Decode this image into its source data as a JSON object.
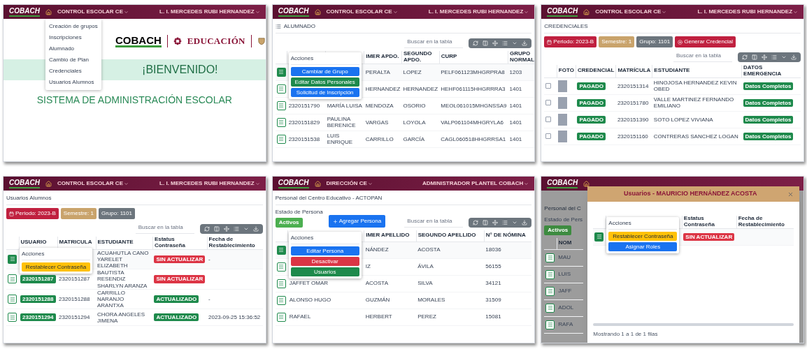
{
  "panels": [
    {
      "kind": "welcome",
      "header": {
        "logo": "COBACH",
        "menu": "CONTROL ESCOLAR CE",
        "user": "L. I. MERCEDES RUBI HERNANDEZ"
      },
      "dropdown": [
        "Creación de grupos",
        "Inscripciones",
        "Alumnado",
        "Cambio de Plan",
        "Credenciales",
        "Usuarios Alumnos"
      ],
      "brand": {
        "logo": "COBACH",
        "education": "EDUCACIÓN"
      },
      "banner": "¡BIENVENIDO!",
      "subtitle": "SISTEMA DE ADMINISTRACIÓN ESCOLAR"
    },
    {
      "kind": "table",
      "header": {
        "logo": "COBACH",
        "menu": "CONTROL ESCOLAR CE",
        "user": "L. I. MERCEDES RUBI HERNANDEZ"
      },
      "title": "ALUMNADO",
      "title_icon": true,
      "search": {
        "placeholder": "Buscar en la tabla"
      },
      "columns": [
        null,
        null,
        "IMER APDO.",
        "SEGUNDO APDO.",
        "CURP",
        "GRUPO NORMAL"
      ],
      "rows": [
        {
          "selected": true,
          "cells": [
            null,
            null,
            {
              "kind": "text",
              "text": "PERALTA"
            },
            {
              "kind": "text",
              "text": "LOPEZ"
            },
            {
              "kind": "text",
              "text": "PELF061123MHGRPRA8"
            },
            {
              "kind": "text",
              "text": "1203"
            }
          ]
        },
        {
          "selected": false,
          "cells": [
            null,
            null,
            {
              "kind": "text",
              "text": "HERNANDEZ"
            },
            {
              "kind": "text",
              "text": "HERNANDEZ"
            },
            {
              "kind": "text",
              "text": "HEHF061115HHGRRRA3"
            },
            {
              "kind": "text",
              "text": "1401"
            }
          ]
        },
        {
          "selected": false,
          "cells": [
            {
              "kind": "text",
              "text": "2320151790"
            },
            {
              "kind": "text",
              "text": "MARÍA LUISA"
            },
            {
              "kind": "text",
              "text": "MENDOZA"
            },
            {
              "kind": "text",
              "text": "OSORIO"
            },
            {
              "kind": "text",
              "text": "MEOL061015MHGNSSA9"
            },
            {
              "kind": "text",
              "text": "1401"
            }
          ]
        },
        {
          "selected": false,
          "cells": [
            {
              "kind": "text",
              "text": "2320151829"
            },
            {
              "kind": "text",
              "text": "PAULINA BERENICE"
            },
            {
              "kind": "text",
              "text": "VARGAS"
            },
            {
              "kind": "text",
              "text": "LOYOLA"
            },
            {
              "kind": "text",
              "text": "VALP061104MHGRYLA6"
            },
            {
              "kind": "text",
              "text": "1401"
            }
          ]
        },
        {
          "selected": false,
          "cells": [
            {
              "kind": "text",
              "text": "2320151538"
            },
            {
              "kind": "text",
              "text": "LUIS ENRIQUE"
            },
            {
              "kind": "text",
              "text": "CARRILLO"
            },
            {
              "kind": "text",
              "text": "GARCÍA"
            },
            {
              "kind": "text",
              "text": "CAGL060518HHGRRSA1"
            },
            {
              "kind": "text",
              "text": "1401"
            }
          ]
        }
      ],
      "actions_menu": {
        "title": "Acciones",
        "buttons": [
          {
            "label": "Cambiar de Grupo",
            "color": "#1a73f0"
          },
          {
            "label": "Editar Datos Personales",
            "color": "#1e8a4c"
          },
          {
            "label": "Solicitud de Inscripción",
            "color": "#1a73f0"
          }
        ]
      }
    },
    {
      "kind": "table",
      "header": {
        "logo": "COBACH",
        "menu": "CONTROL ESCOLAR CE",
        "user": "L. I. MERCEDES RUBI HERNANDEZ"
      },
      "title": "CREDENCIALES",
      "search": {
        "placeholder": "Buscar en la tabla"
      },
      "chips": [
        {
          "kind": "period",
          "label": "Periodo: 2023-B",
          "color": "#c0203f"
        },
        {
          "kind": "semester",
          "label": "Semestre: 1",
          "color": "#c9a36b"
        },
        {
          "kind": "group",
          "label": "Grupo: 1101",
          "color": "#6c757d"
        },
        {
          "kind": "action",
          "label": "Generar Credencial",
          "color": "#c0203f"
        }
      ],
      "columns": [
        "FOTO",
        "CREDENCIAL",
        "MATRÍCULA",
        "ESTUDIANTE",
        "DATOS EMERGENCIA"
      ],
      "rows": [
        {
          "checked": false,
          "cells": [
            {
              "kind": "photo"
            },
            {
              "kind": "badge",
              "text": "PAGADO",
              "color": "#1e8a4c"
            },
            {
              "kind": "text",
              "text": "2320151314"
            },
            {
              "kind": "text",
              "text": "HINOJOSA HERNANDEZ KEVIN OBED"
            },
            {
              "kind": "badge",
              "text": "Datos Completos",
              "color": "#1e8a4c"
            }
          ]
        },
        {
          "checked": false,
          "cells": [
            {
              "kind": "photo"
            },
            {
              "kind": "badge",
              "text": "PAGADO",
              "color": "#1e8a4c"
            },
            {
              "kind": "text",
              "text": "2320151780"
            },
            {
              "kind": "text",
              "text": "VALLE MARTINEZ FERNANDO EMILIANO"
            },
            {
              "kind": "badge",
              "text": "Datos Completos",
              "color": "#1e8a4c"
            }
          ]
        },
        {
          "checked": false,
          "cells": [
            {
              "kind": "photo"
            },
            {
              "kind": "badge",
              "text": "PAGADO",
              "color": "#1e8a4c"
            },
            {
              "kind": "text",
              "text": "2320151390"
            },
            {
              "kind": "text",
              "text": "SOTO LOPEZ VIVIANA"
            },
            {
              "kind": "badge",
              "text": "Datos Completos",
              "color": "#1e8a4c"
            }
          ]
        },
        {
          "checked": false,
          "cells": [
            {
              "kind": "photo"
            },
            {
              "kind": "badge",
              "text": "PAGADO",
              "color": "#1e8a4c"
            },
            {
              "kind": "text",
              "text": "2320151160"
            },
            {
              "kind": "text",
              "text": "CONTRERAS SANCHEZ LOGAN"
            },
            {
              "kind": "badge",
              "text": "Datos Completos",
              "color": "#1e8a4c"
            }
          ]
        }
      ]
    },
    {
      "kind": "table",
      "header": {
        "logo": "COBACH",
        "menu": "CONTROL ESCOLAR CE",
        "user": "L. I. MERCEDES RUBI HERNANDEZ"
      },
      "title": "Usuarios Alumnos",
      "search": {
        "placeholder": "Buscar en la tabla"
      },
      "chips": [
        {
          "kind": "period",
          "label": "Periodo: 2023-B",
          "color": "#c0203f"
        },
        {
          "kind": "semester",
          "label": "Semestre: 1",
          "color": "#c9a36b"
        },
        {
          "kind": "group",
          "label": "Grupo: 1101",
          "color": "#6c757d"
        }
      ],
      "columns": [
        "USUARIO",
        "MATRICULA",
        "ESTUDIANTE",
        "Estatus Contraseña",
        "Fecha de Restablecimiento"
      ],
      "rows": [
        {
          "selected": true,
          "cells": [
            null,
            null,
            {
              "kind": "text",
              "text": "ACUAHUTLA CANO YARELET ELIZABETH"
            },
            {
              "kind": "badge",
              "text": "SIN ACTUALIZAR",
              "color": "#dc3545"
            },
            {
              "kind": "text",
              "text": "-"
            }
          ]
        },
        {
          "selected": false,
          "cells": [
            {
              "kind": "badge",
              "text": "2320151287",
              "color": "#1e8a4c"
            },
            {
              "kind": "text",
              "text": "2320151287"
            },
            {
              "kind": "text",
              "text": "BAUTISTA RESENDIZ SHARLYN ARANZA"
            },
            {
              "kind": "badge",
              "text": "SIN ACTUALIZAR",
              "color": "#dc3545"
            },
            null
          ]
        },
        {
          "selected": false,
          "cells": [
            {
              "kind": "badge",
              "text": "2320151288",
              "color": "#1e8a4c"
            },
            {
              "kind": "text",
              "text": "2320151288"
            },
            {
              "kind": "text",
              "text": "CARRILLO NARANJO ARANTXA"
            },
            {
              "kind": "badge",
              "text": "ACTUALIZADO",
              "color": "#1e8a4c"
            },
            {
              "kind": "text",
              "text": "-"
            }
          ]
        },
        {
          "selected": false,
          "cells": [
            {
              "kind": "badge",
              "text": "2320151294",
              "color": "#1e8a4c"
            },
            {
              "kind": "text",
              "text": "2320151294"
            },
            {
              "kind": "text",
              "text": "CHORA ANGELES JIMENA"
            },
            {
              "kind": "badge",
              "text": "ACTUALIZADO",
              "color": "#1e8a4c"
            },
            {
              "kind": "text",
              "text": "2023-09-25 15:36:52"
            }
          ]
        }
      ],
      "actions_menu": {
        "title": "Acciones",
        "buttons": [
          {
            "label": "Restablecer Contraseña",
            "color": "#ffc107"
          }
        ]
      }
    },
    {
      "kind": "table",
      "header": {
        "logo": "COBACH",
        "menu": "DIRECCIÓN CE",
        "user": "ADMINISTRADOR PLANTEL COBACH"
      },
      "title": "Personal del Centro Educativo - ACTOPAN",
      "search": {
        "placeholder": "Buscar en la tabla"
      },
      "state_filter": {
        "label": "Estado de Persona",
        "value": "Activos",
        "color": "#4caf50"
      },
      "add_button": {
        "label": "Agregar Persona",
        "color": "#1a73f0"
      },
      "columns": [
        null,
        "IMER APELLIDO",
        "SEGUNDO APELLIDO",
        "N° DE NÓMINA"
      ],
      "rows": [
        {
          "selected": true,
          "cells": [
            null,
            {
              "kind": "text",
              "text": "NÁNDEZ"
            },
            {
              "kind": "text",
              "text": "ACOSTA"
            },
            {
              "kind": "text",
              "text": "18036"
            }
          ]
        },
        {
          "selected": false,
          "cells": [
            null,
            {
              "kind": "text",
              "text": "IZ"
            },
            {
              "kind": "text",
              "text": "ÁVILA"
            },
            {
              "kind": "text",
              "text": "56155"
            }
          ]
        },
        {
          "selected": false,
          "cells": [
            {
              "kind": "text",
              "text": "JAFFET OMAR"
            },
            {
              "kind": "text",
              "text": "ACOSTA"
            },
            {
              "kind": "text",
              "text": "SILVA"
            },
            {
              "kind": "text",
              "text": "34121"
            }
          ]
        },
        {
          "selected": false,
          "cells": [
            {
              "kind": "text",
              "text": "ALONSO HUGO"
            },
            {
              "kind": "text",
              "text": "GUZMÁN"
            },
            {
              "kind": "text",
              "text": "MORALES"
            },
            {
              "kind": "text",
              "text": "31509"
            }
          ]
        },
        {
          "selected": false,
          "cells": [
            {
              "kind": "text",
              "text": "RAFAEL"
            },
            {
              "kind": "text",
              "text": "HERBERT"
            },
            {
              "kind": "text",
              "text": "PEREZ"
            },
            {
              "kind": "text",
              "text": "15081"
            }
          ]
        }
      ],
      "actions_menu": {
        "title": "Acciones",
        "buttons": [
          {
            "label": "Editar Persona",
            "color": "#1a73f0"
          },
          {
            "label": "Desactivar",
            "color": "#dc3545"
          },
          {
            "label": "Usuarios",
            "color": "#1e8a4c"
          }
        ]
      }
    },
    {
      "kind": "modal",
      "header": {
        "logo": "COBACH"
      },
      "title": "Personal del C",
      "state_filter": {
        "label": "Estado de Pers",
        "value": "Activos",
        "color": "#3d8b40"
      },
      "columns": [
        "NOM"
      ],
      "rows": [
        {
          "selected": false,
          "cells": [
            {
              "kind": "text",
              "text": "MAU"
            }
          ]
        },
        {
          "selected": false,
          "cells": [
            {
              "kind": "text",
              "text": "LUIS"
            }
          ]
        },
        {
          "selected": false,
          "cells": [
            {
              "kind": "text",
              "text": "JAFF"
            }
          ]
        },
        {
          "selected": false,
          "cells": [
            {
              "kind": "text",
              "text": "ADOL"
            }
          ]
        },
        {
          "selected": false,
          "cells": [
            {
              "kind": "text",
              "text": "RAFA"
            }
          ]
        }
      ],
      "modal": {
        "title": "Usuarios - MAURICIO HERNÁNDEZ ACOSTA",
        "columns": [
          null,
          "Estatus Contraseña",
          "Fecha de Restablecimiento"
        ],
        "rows": [
          {
            "selected": true,
            "cells": [
              null,
              {
                "kind": "badge",
                "text": "SIN ACTUALIZAR",
                "color": "#dc3545"
              },
              null
            ]
          }
        ],
        "actions_menu": {
          "title": "Acciones",
          "buttons": [
            {
              "label": "Restablecer Contraseña",
              "color": "#ffc107"
            },
            {
              "label": "Asignar Roles",
              "color": "#1a73f0"
            }
          ]
        },
        "footer": "Mostrando 1 a 1 de 1 filas"
      }
    }
  ]
}
